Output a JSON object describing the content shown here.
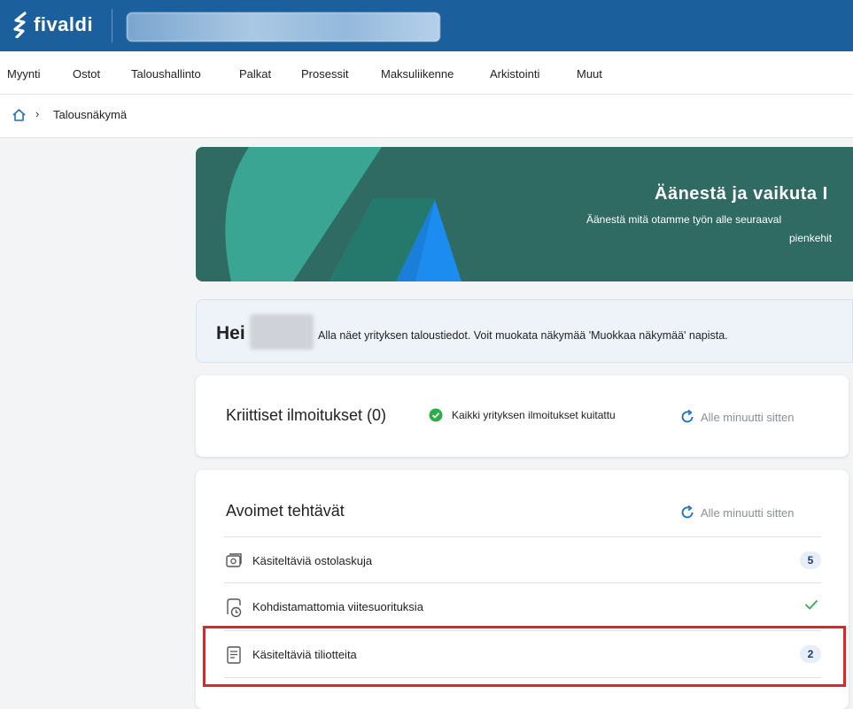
{
  "app": {
    "logo_text": "fivaldi"
  },
  "menu": {
    "items": [
      {
        "label": "Myynti"
      },
      {
        "label": "Ostot"
      },
      {
        "label": "Taloushallinto"
      },
      {
        "label": "Palkat"
      },
      {
        "label": "Prosessit"
      },
      {
        "label": "Maksuliikenne"
      },
      {
        "label": "Arkistointi"
      },
      {
        "label": "Muut"
      }
    ]
  },
  "breadcrumb": {
    "separator": "›",
    "current": "Talousnäkymä"
  },
  "banner": {
    "title": "Äänestä ja vaikuta I",
    "subtitle_line1": "Äänestä mitä otamme työn alle seuraaval",
    "subtitle_line2": "pienkehit"
  },
  "greeting": {
    "hello": "Hei",
    "text": "Alla näet yrityksen taloustiedot. Voit muokata näkymää 'Muokkaa näkymää' napista."
  },
  "critical": {
    "title": "Kriittiset ilmoitukset (0)",
    "status_text": "Kaikki yrityksen ilmoitukset kuitattu",
    "refresh_text": "Alle minuutti sitten"
  },
  "tasks": {
    "title": "Avoimet tehtävät",
    "refresh_text": "Alle minuutti sitten",
    "items": [
      {
        "label": "Käsiteltäviä ostolaskuja",
        "count": "5",
        "icon": "invoice-icon"
      },
      {
        "label": "Kohdistamattomia viitesuorituksia",
        "icon": "payment-clock-icon",
        "status": "check-icon"
      },
      {
        "label": "Käsiteltäviä tiliotteita",
        "count": "2",
        "icon": "document-list-icon"
      }
    ]
  },
  "colors": {
    "topbar": "#1b5f9c",
    "banner": "#2f6c66",
    "accent_blue": "#1d8cf0",
    "success_green": "#2bae48",
    "highlight_red": "#e32326"
  }
}
